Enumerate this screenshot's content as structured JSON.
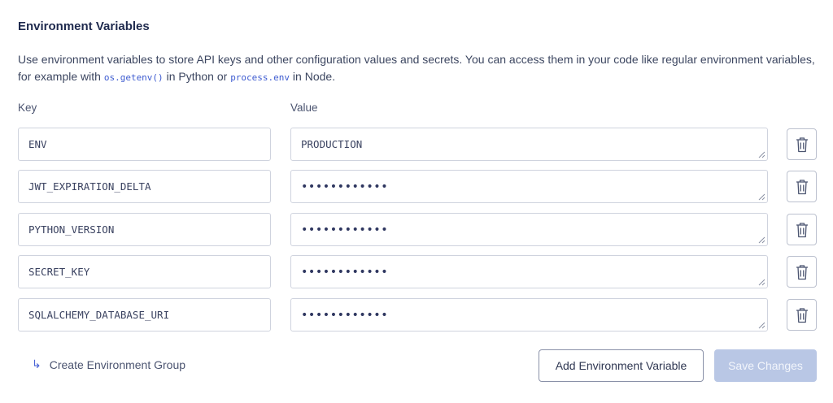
{
  "section": {
    "title": "Environment Variables",
    "desc_part1": "Use environment variables to store API keys and other configuration values and secrets. You can access them in your code like regular environment variables, for example with ",
    "code1": "os.getenv()",
    "desc_part2": " in Python or ",
    "code2": "process.env",
    "desc_part3": " in Node."
  },
  "columns": {
    "key": "Key",
    "value": "Value"
  },
  "rows": [
    {
      "key": "ENV",
      "value": "PRODUCTION"
    },
    {
      "key": "JWT_EXPIRATION_DELTA",
      "value": "••••••••••••"
    },
    {
      "key": "PYTHON_VERSION",
      "value": "••••••••••••"
    },
    {
      "key": "SECRET_KEY",
      "value": "••••••••••••"
    },
    {
      "key": "SQLALCHEMY_DATABASE_URI",
      "value": "••••••••••••"
    }
  ],
  "actions": {
    "create_group": "Create Environment Group",
    "create_group_icon": "arrow-return-right-icon",
    "add_variable": "Add Environment Variable",
    "save": "Save Changes",
    "delete_icon": "trash-icon"
  },
  "colors": {
    "accent": "#4a63d6",
    "save_disabled_bg": "#b9c7e5",
    "border": "#cfd3de"
  }
}
